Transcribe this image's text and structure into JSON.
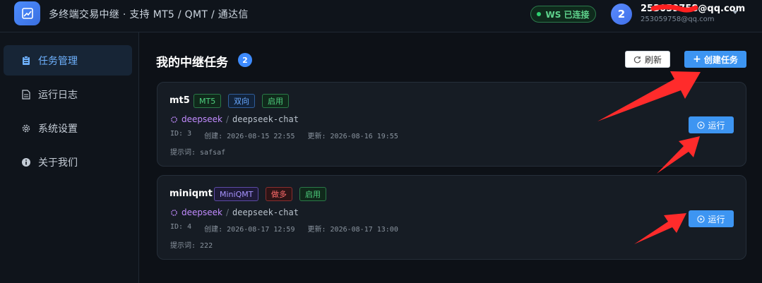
{
  "header": {
    "app_title": "多终端交易中继 · 支持 MT5 / QMT / 通达信",
    "ws_status": "WS 已连接",
    "avatar_initial": "2",
    "user_email": "253059758@qq.com",
    "user_email_sub": "253059758@qq.com"
  },
  "sidebar": {
    "items": [
      {
        "label": "任务管理",
        "icon": "clipboard-icon",
        "active": true
      },
      {
        "label": "运行日志",
        "icon": "document-icon",
        "active": false
      },
      {
        "label": "系统设置",
        "icon": "gear-icon",
        "active": false
      },
      {
        "label": "关于我们",
        "icon": "info-icon",
        "active": false
      }
    ]
  },
  "main": {
    "title": "我的中继任务",
    "count": "2",
    "refresh_label": "刷新",
    "create_label": "创建任务",
    "run_label": "运行",
    "tasks": [
      {
        "name": "mt5",
        "tags": [
          "MT5",
          "双向",
          "启用"
        ],
        "provider": "deepseek",
        "model": "deepseek-chat",
        "id_text": "ID: 3",
        "created_text": "创建: 2026-08-15 22:55",
        "updated_text": "更新: 2026-08-16 19:55",
        "prompt_text": "提示词: safsaf"
      },
      {
        "name": "miniqmt",
        "tags": [
          "MiniQMT",
          "做多",
          "启用"
        ],
        "provider": "deepseek",
        "model": "deepseek-chat",
        "id_text": "ID: 4",
        "created_text": "创建: 2026-08-17 12:59",
        "updated_text": "更新: 2026-08-17 13:00",
        "prompt_text": "提示词: 222"
      }
    ]
  },
  "colors": {
    "accent": "#3d95f2",
    "annotation_arrow": "#ff2b2b"
  }
}
